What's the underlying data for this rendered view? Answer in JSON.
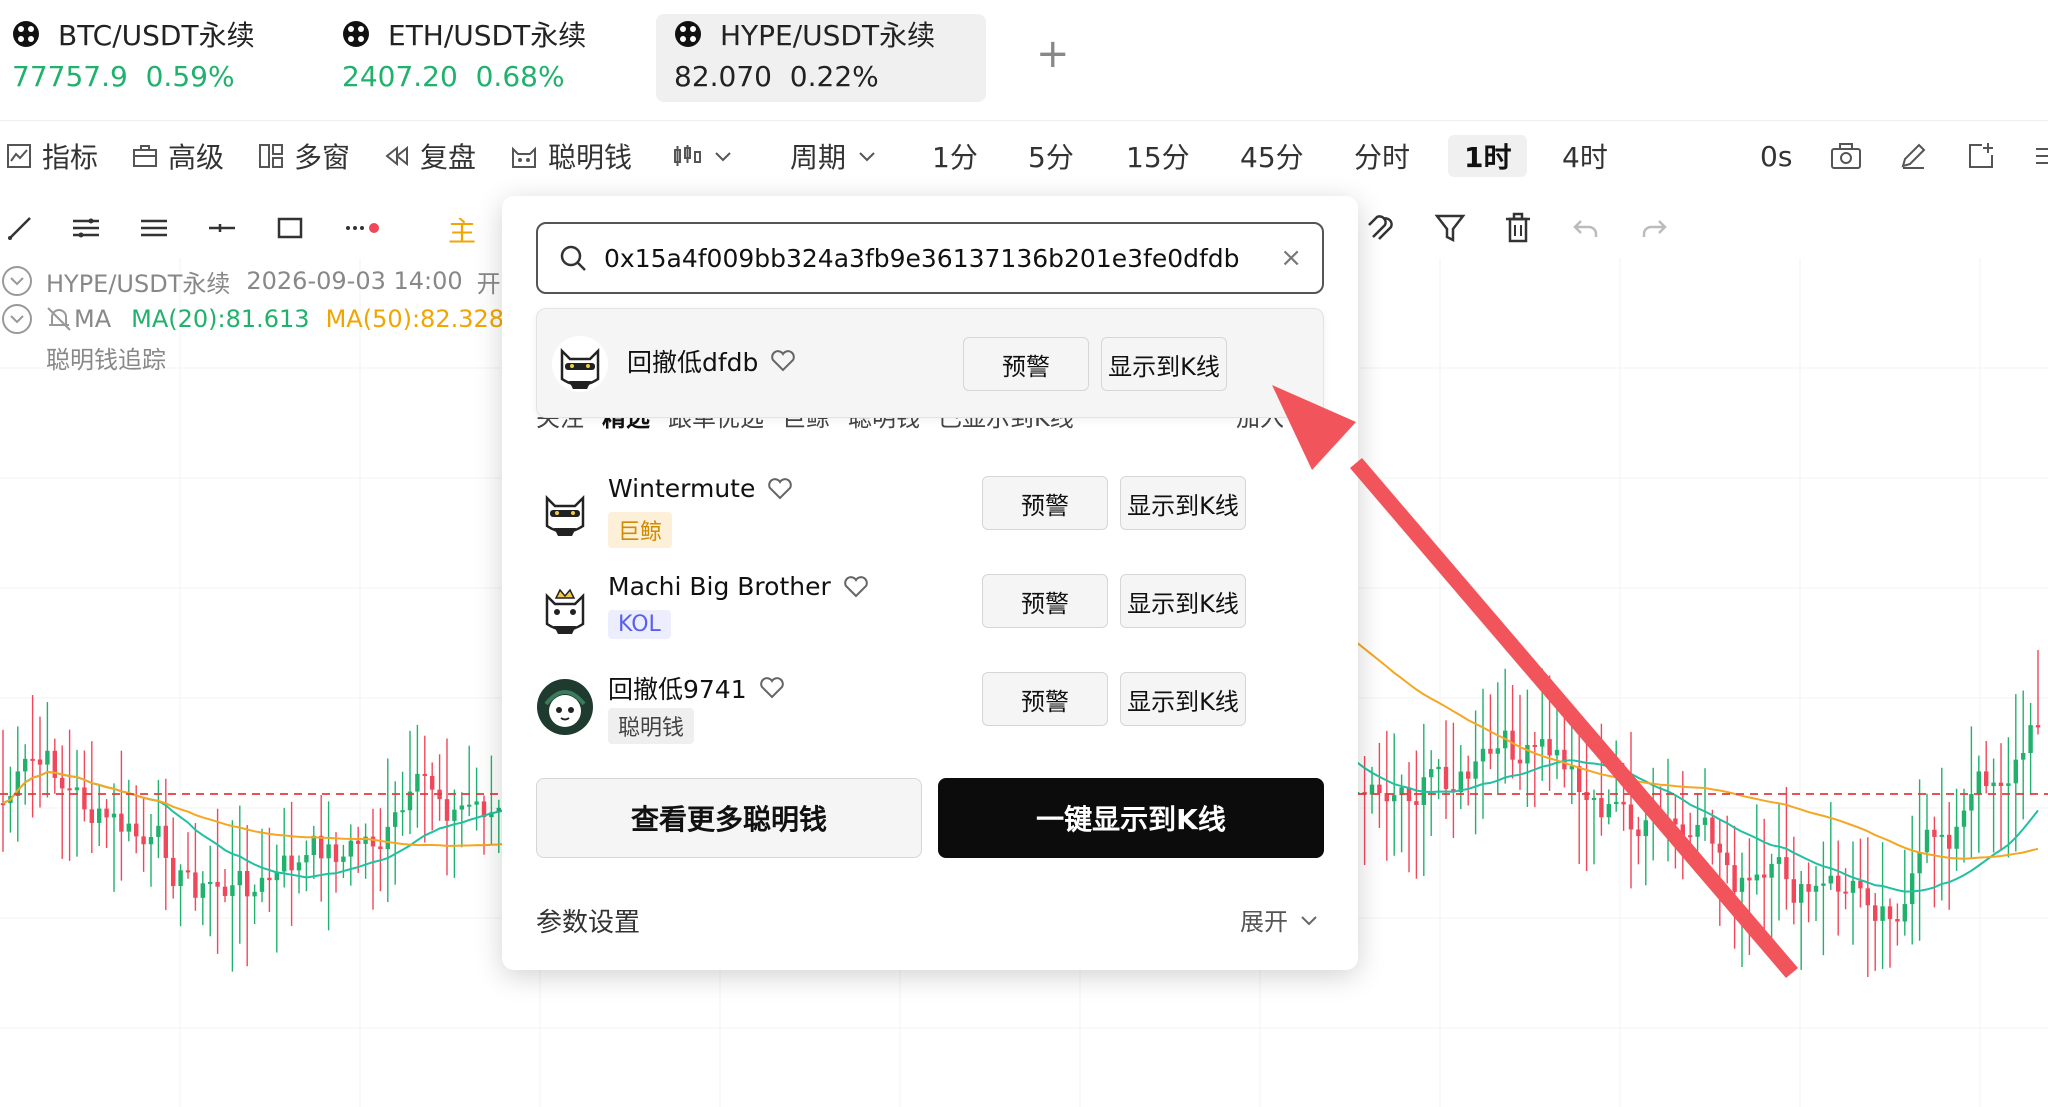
{
  "pair_tabs": [
    {
      "name": "BTC/USDT永续",
      "price": "77757.9",
      "change": "0.59%"
    },
    {
      "name": "ETH/USDT永续",
      "price": "2407.20",
      "change": "0.68%"
    },
    {
      "name": "HYPE/USDT永续",
      "price": "82.070",
      "change": "0.22%"
    }
  ],
  "add_tab_label": "+",
  "toolbar": {
    "indicator": "指标",
    "advanced": "高级",
    "multi_window": "多窗",
    "replay": "复盘",
    "smart_money": "聪明钱",
    "period": "周期",
    "intervals": [
      "1分",
      "5分",
      "15分",
      "45分",
      "分时",
      "1时",
      "4时"
    ],
    "active_interval": "1时",
    "countdown": "0s"
  },
  "draw_tools": {
    "main_label": "主"
  },
  "legend": {
    "title": "HYPE/USDT永续",
    "datetime": "2026-09-03 14:00",
    "open_label": "开",
    "ma_label": "MA",
    "ma20": "MA(20):81.613",
    "ma50": "MA(50):82.328",
    "tracker": "聪明钱追踪"
  },
  "popup": {
    "search_value": "0x15a4f009bb324a3fb9e36137136b201e3fe0dfdb",
    "clear_icon": "×",
    "result": {
      "name": "回撤低dfdb",
      "alert": "预警",
      "show": "显示到K线"
    },
    "tabs_peek": [
      "关注",
      "精选",
      "跟单优选",
      "巨鲸",
      "聪明钱",
      "已显示到K线"
    ],
    "tabs_peek_right": "加入",
    "list": [
      {
        "name": "Wintermute",
        "badge": "巨鲸",
        "alert": "预警",
        "show": "显示到K线"
      },
      {
        "name": "Machi Big Brother",
        "badge": "KOL",
        "alert": "预警",
        "show": "显示到K线"
      },
      {
        "name": "回撤低9741",
        "badge": "聪明钱",
        "alert": "预警",
        "show": "显示到K线"
      }
    ],
    "more_button": "查看更多聪明钱",
    "show_all_button": "一键显示到K线",
    "params_label": "参数设置",
    "expand_label": "展开"
  },
  "colors": {
    "up": "#20b26c",
    "down": "#f0475a",
    "ma20": "#20c0a0",
    "ma50": "#f5a623",
    "price_line": "#e33b3b",
    "arrow": "#f2545b",
    "badge_whale_bg": "#fdf0d8",
    "badge_whale_fg": "#d28a00",
    "badge_kol_bg": "#eceefe",
    "badge_kol_fg": "#5a5ff0",
    "badge_smart_bg": "#efefef",
    "badge_smart_fg": "#444444"
  }
}
